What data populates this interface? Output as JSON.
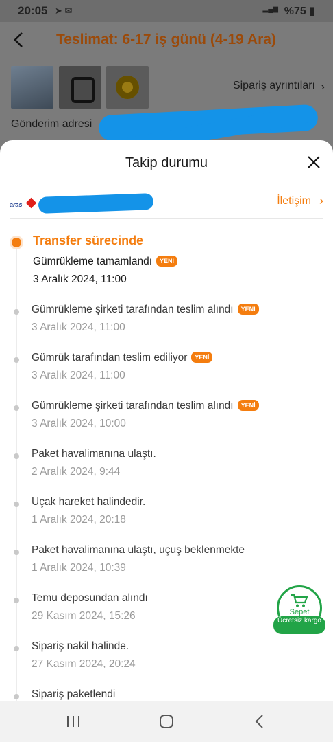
{
  "status_bar": {
    "time": "20:05",
    "battery": "%75",
    "network": "Vo))\nLTE1"
  },
  "header": {
    "title": "Teslimat: 6-17 iş günü (4-19 Ara)",
    "order_details": "Sipariş ayrıntıları",
    "shipping_label": "Gönderim adresi"
  },
  "sheet": {
    "title": "Takip durumu",
    "contact": "İletişim",
    "carrier_logo_text": "aras"
  },
  "tracking": {
    "current_status": "Transfer sürecinde",
    "current_event": {
      "title": "Gümrükleme tamamlandı",
      "date": "3 Aralık 2024, 11:00",
      "badge": "YENİ"
    },
    "events": [
      {
        "title": "Gümrükleme şirketi tarafından teslim alındı",
        "date": "3 Aralık 2024, 11:00",
        "badge": "YENİ"
      },
      {
        "title": "Gümrük tarafından teslim ediliyor",
        "date": "3 Aralık 2024, 11:00",
        "badge": "YENİ"
      },
      {
        "title": "Gümrükleme şirketi tarafından teslim alındı",
        "date": "3 Aralık 2024, 10:00",
        "badge": "YENİ"
      },
      {
        "title": "Paket havalimanına ulaştı.",
        "date": "2 Aralık 2024, 9:44",
        "badge": ""
      },
      {
        "title": "Uçak hareket halindedir.",
        "date": "1 Aralık 2024, 20:18",
        "badge": ""
      },
      {
        "title": "Paket havalimanına ulaştı, uçuş beklenmekte",
        "date": "1 Aralık 2024, 10:39",
        "badge": ""
      },
      {
        "title": "Temu deposundan alındı",
        "date": "29 Kasım 2024, 15:26",
        "badge": ""
      },
      {
        "title": "Sipariş nakil halinde.",
        "date": "27 Kasım 2024, 20:24",
        "badge": ""
      },
      {
        "title": "Sipariş paketlendi",
        "date": "",
        "badge": ""
      }
    ]
  },
  "cart": {
    "label": "Sepet",
    "free_shipping": "Ücretsiz kargo"
  },
  "colors": {
    "accent": "#f47d0f",
    "cart_green": "#22a447",
    "redaction": "#1493e8"
  }
}
